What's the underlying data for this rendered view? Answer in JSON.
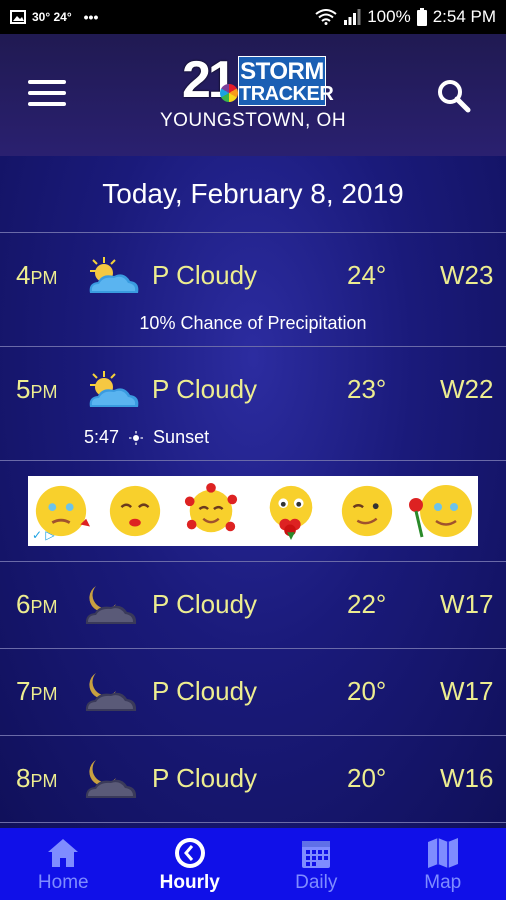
{
  "status_bar": {
    "temps": "30° 24°",
    "more": "•••",
    "battery": "100%",
    "time": "2:54 PM"
  },
  "header": {
    "logo_number": "21",
    "logo_word1": "STORM",
    "logo_word2": "TRACKER",
    "location": "YOUNGSTOWN, OH",
    "menu_icon": "hamburger-icon",
    "search_icon": "search-icon"
  },
  "date_title": "Today, February 8, 2019",
  "hours": [
    {
      "hour": "4",
      "ampm": "PM",
      "condition": "P Cloudy",
      "temp": "24°",
      "wind": "W23",
      "icon": "partly-sunny-icon",
      "note": "10% Chance of Precipitation"
    },
    {
      "hour": "5",
      "ampm": "PM",
      "condition": "P Cloudy",
      "temp": "23°",
      "wind": "W22",
      "icon": "partly-sunny-icon",
      "sunset_time": "5:47",
      "sunset_label": "Sunset"
    },
    {
      "hour": "6",
      "ampm": "PM",
      "condition": "P Cloudy",
      "temp": "22°",
      "wind": "W17",
      "icon": "moon-cloud-icon"
    },
    {
      "hour": "7",
      "ampm": "PM",
      "condition": "P Cloudy",
      "temp": "20°",
      "wind": "W17",
      "icon": "moon-cloud-icon"
    },
    {
      "hour": "8",
      "ampm": "PM",
      "condition": "P Cloudy",
      "temp": "20°",
      "wind": "W16",
      "icon": "moon-cloud-icon"
    }
  ],
  "nav": [
    {
      "label": "Home",
      "icon": "home-icon",
      "active": false
    },
    {
      "label": "Hourly",
      "icon": "clock-icon",
      "active": true
    },
    {
      "label": "Daily",
      "icon": "calendar-icon",
      "active": false
    },
    {
      "label": "Map",
      "icon": "map-icon",
      "active": false
    }
  ],
  "colors": {
    "value_text": "#eded90",
    "nav_bg": "#1010e8",
    "nav_inactive": "#7f8cff"
  }
}
